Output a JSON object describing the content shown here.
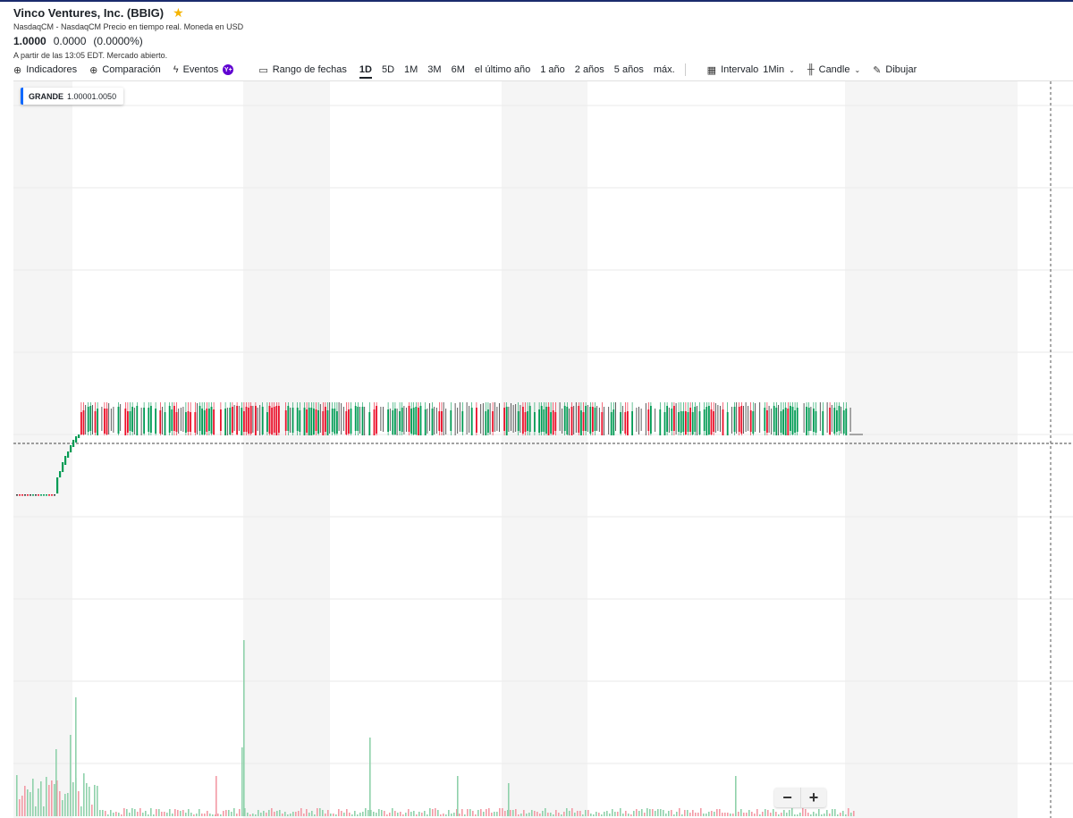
{
  "header": {
    "title": "Vinco Ventures, Inc. (BBIG)",
    "subtitle": "NasdaqCM - NasdaqCM Precio en tiempo real. Moneda en USD",
    "price": "1.0000",
    "change": "0.0000",
    "change_pct": "(0.0000%)",
    "as_of": "A partir de las 13:05 EDT. Mercado abierto."
  },
  "toolbar": {
    "indicators": "Indicadores",
    "comparison": "Comparación",
    "events": "Eventos",
    "events_badge": "Y+",
    "date_range": "Rango de fechas",
    "ranges": [
      "1D",
      "5D",
      "1M",
      "3M",
      "6M",
      "el último año",
      "1 año",
      "2 años",
      "5 años",
      "máx."
    ],
    "active_range": "1D",
    "interval_label": "Intervalo",
    "interval_value": "1Min",
    "chart_type": "Candle",
    "draw": "Dibujar"
  },
  "legend": {
    "symbol": "GRANDE",
    "value": "1.00001.0050"
  },
  "zoom": {
    "minus": "−",
    "plus": "+"
  },
  "colors": {
    "up": "#009b54",
    "down": "#eb0f29",
    "neutral": "#333333",
    "volume_up": "#8fd1ab",
    "volume_down": "#f29aa5",
    "band": "#f5f5f5",
    "accent": "#0f69ff"
  },
  "chart_data": {
    "type": "candlestick",
    "price_range_approx": [
      0.9,
      1.01
    ],
    "phases": [
      {
        "segment": "pre-open",
        "level": 0.985,
        "trend": "flat"
      },
      {
        "segment": "ramp",
        "from": 0.985,
        "to": 1.0,
        "trend": "up"
      },
      {
        "segment": "session",
        "level_low": 1.0,
        "level_high": 1.005,
        "trend": "range-bound"
      }
    ],
    "last_price_line": 1.0,
    "volume_spikes": [
      "early session",
      "around first shaded band",
      "scattered afternoon"
    ]
  }
}
